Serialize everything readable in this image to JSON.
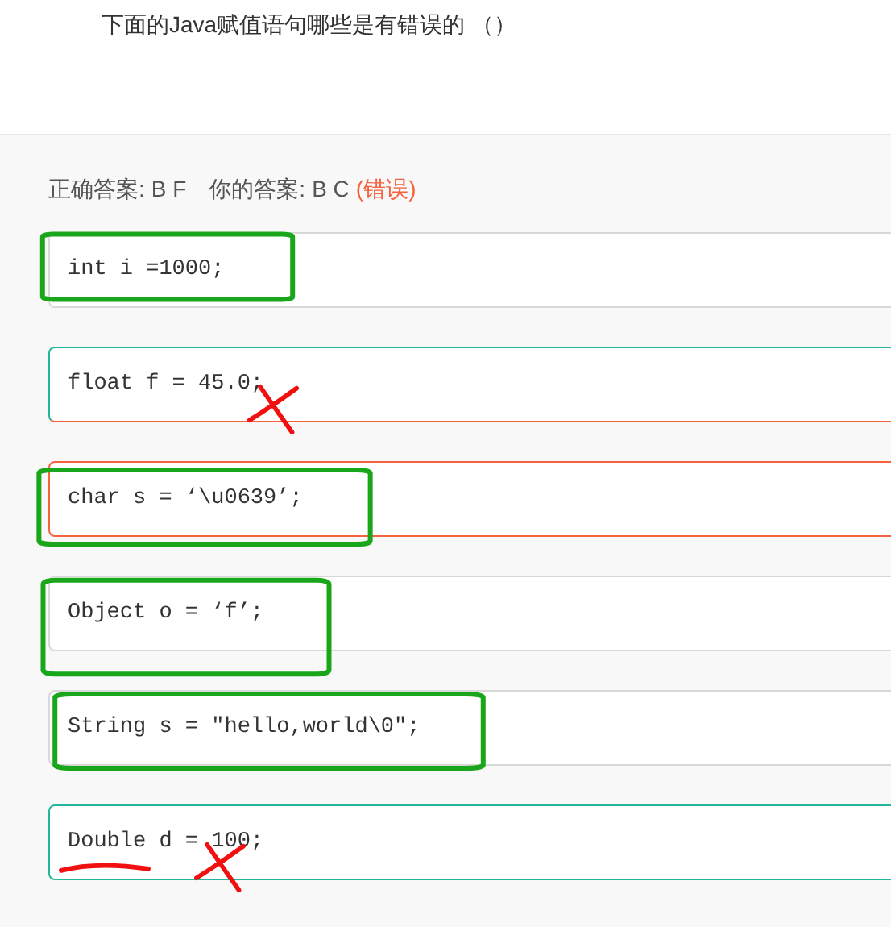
{
  "question": "下面的Java赋值语句哪些是有错误的 （）",
  "answer": {
    "correct_label": "正确答案:",
    "correct": "B F",
    "yours_label": "你的答案:",
    "yours": "B C",
    "verdict": "(错误)"
  },
  "options": [
    {
      "code": "int i =1000;",
      "correct": false,
      "chosen": false,
      "marks": [
        {
          "kind": "box"
        }
      ]
    },
    {
      "code": "float f = 45.0;",
      "correct": true,
      "chosen": true,
      "marks": [
        {
          "kind": "cross"
        }
      ]
    },
    {
      "code": "char s = ‘\\u0639’;",
      "correct": false,
      "chosen": true,
      "marks": [
        {
          "kind": "box"
        }
      ]
    },
    {
      "code": "Object o = ‘f’;",
      "correct": false,
      "chosen": false,
      "marks": [
        {
          "kind": "box"
        }
      ]
    },
    {
      "code": "String s = \"hello,world\\0\";",
      "correct": false,
      "chosen": false,
      "marks": [
        {
          "kind": "box"
        }
      ]
    },
    {
      "code": "Double d = 100;",
      "correct": true,
      "chosen": false,
      "marks": [
        {
          "kind": "underline"
        },
        {
          "kind": "cross"
        }
      ]
    }
  ]
}
